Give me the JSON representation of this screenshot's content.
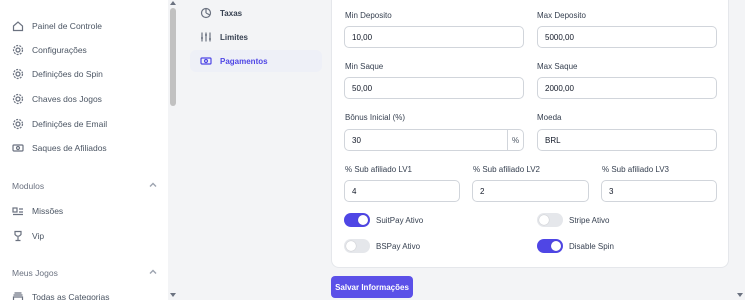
{
  "sidebar": {
    "items": [
      {
        "label": "Painel de Controle",
        "icon": "home-icon"
      },
      {
        "label": "Configurações",
        "icon": "gear-icon"
      },
      {
        "label": "Definições do Spin",
        "icon": "gear-icon"
      },
      {
        "label": "Chaves dos Jogos",
        "icon": "gear-icon"
      },
      {
        "label": "Definições de Email",
        "icon": "gear-icon"
      },
      {
        "label": "Saques de Afiliados",
        "icon": "cash-icon"
      }
    ],
    "section_modulos": "Modulos",
    "modulos_items": [
      {
        "label": "Missões",
        "icon": "tasks-icon"
      },
      {
        "label": "Vip",
        "icon": "trophy-icon"
      }
    ],
    "section_meus_jogos": "Meus Jogos",
    "meus_jogos_items": [
      {
        "label": "Todas as Categorias",
        "icon": "category-icon"
      }
    ]
  },
  "submenu": {
    "items": [
      {
        "label": "Taxas",
        "icon": "percent-icon",
        "active": false
      },
      {
        "label": "Limites",
        "icon": "sliders-icon",
        "active": false
      },
      {
        "label": "Pagamentos",
        "icon": "money-icon",
        "active": true
      }
    ]
  },
  "form": {
    "min_deposito_label": "Min Deposito",
    "min_deposito_value": "10,00",
    "max_deposito_label": "Max Deposito",
    "max_deposito_value": "5000,00",
    "min_saque_label": "Min Saque",
    "min_saque_value": "50,00",
    "max_saque_label": "Max Saque",
    "max_saque_value": "2000,00",
    "bonus_label": "Bônus Inicial (%)",
    "bonus_value": "30",
    "bonus_addon": "%",
    "moeda_label": "Moeda",
    "moeda_value": "BRL",
    "sub_lv1_label": "% Sub afiliado LV1",
    "sub_lv1_value": "4",
    "sub_lv2_label": "% Sub afiliado LV2",
    "sub_lv2_value": "2",
    "sub_lv3_label": "% Sub afiliado LV3",
    "sub_lv3_value": "3",
    "toggles": {
      "suitpay": {
        "label": "SuitPay Ativo",
        "on": true
      },
      "stripe": {
        "label": "Stripe Ativo",
        "on": false
      },
      "bspay": {
        "label": "BSPay Ativo",
        "on": false
      },
      "disable_spin": {
        "label": "Disable Spin",
        "on": true
      }
    },
    "save_label": "Salvar Informações"
  },
  "colors": {
    "accent": "#4f46e5",
    "button": "#5b50e8"
  }
}
